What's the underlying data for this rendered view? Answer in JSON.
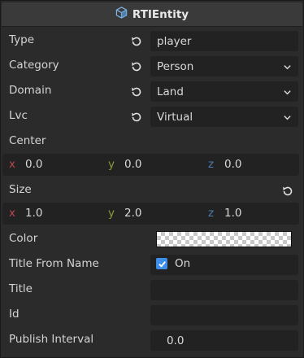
{
  "header": {
    "title": "RTIEntity",
    "icon": "cube-icon"
  },
  "fields": {
    "type": {
      "label": "Type",
      "value": "player"
    },
    "category": {
      "label": "Category",
      "value": "Person"
    },
    "domain": {
      "label": "Domain",
      "value": "Land"
    },
    "lvc": {
      "label": "Lvc",
      "value": "Virtual"
    }
  },
  "center": {
    "label": "Center",
    "x_label": "x",
    "y_label": "y",
    "z_label": "z",
    "x": "0.0",
    "y": "0.0",
    "z": "0.0"
  },
  "size": {
    "label": "Size",
    "x_label": "x",
    "y_label": "y",
    "z_label": "z",
    "x": "1.0",
    "y": "2.0",
    "z": "1.0"
  },
  "color": {
    "label": "Color"
  },
  "title_from_name": {
    "label": "Title From Name",
    "checked": true,
    "check_text": "On"
  },
  "title": {
    "label": "Title",
    "value": ""
  },
  "id": {
    "label": "Id",
    "value": ""
  },
  "publish_interval": {
    "label": "Publish Interval",
    "value": "0.0"
  },
  "colors": {
    "accent": "#3d8ee6",
    "axis_x": "#b9464f",
    "axis_y": "#8c9a3a",
    "axis_z": "#4f7cae"
  }
}
